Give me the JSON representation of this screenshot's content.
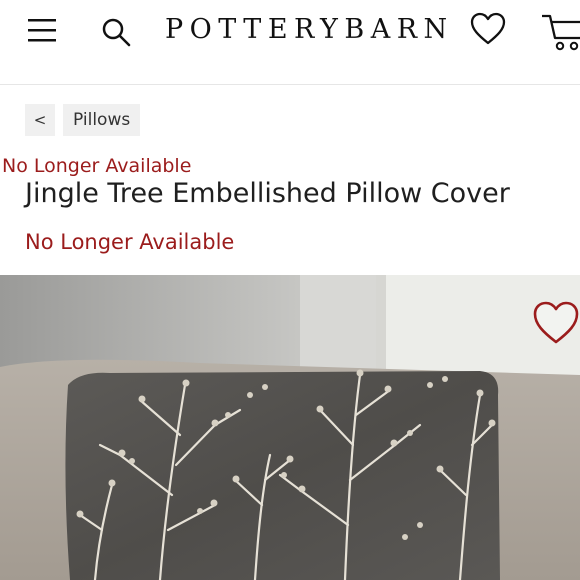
{
  "header": {
    "logo": "POTTERYBARN",
    "icons": [
      "menu-icon",
      "search-icon",
      "heart-icon",
      "cart-icon"
    ]
  },
  "breadcrumb": {
    "back_label": "<",
    "link_label": "Pillows"
  },
  "product": {
    "availability_top": "No Longer Available",
    "title": "Jingle Tree Embellished Pillow Cover",
    "availability_main": "No Longer Available"
  },
  "colors": {
    "accent_red": "#9b1c1c",
    "text": "#1f1f1f",
    "breadcrumb_bg": "#f0f0f0"
  }
}
